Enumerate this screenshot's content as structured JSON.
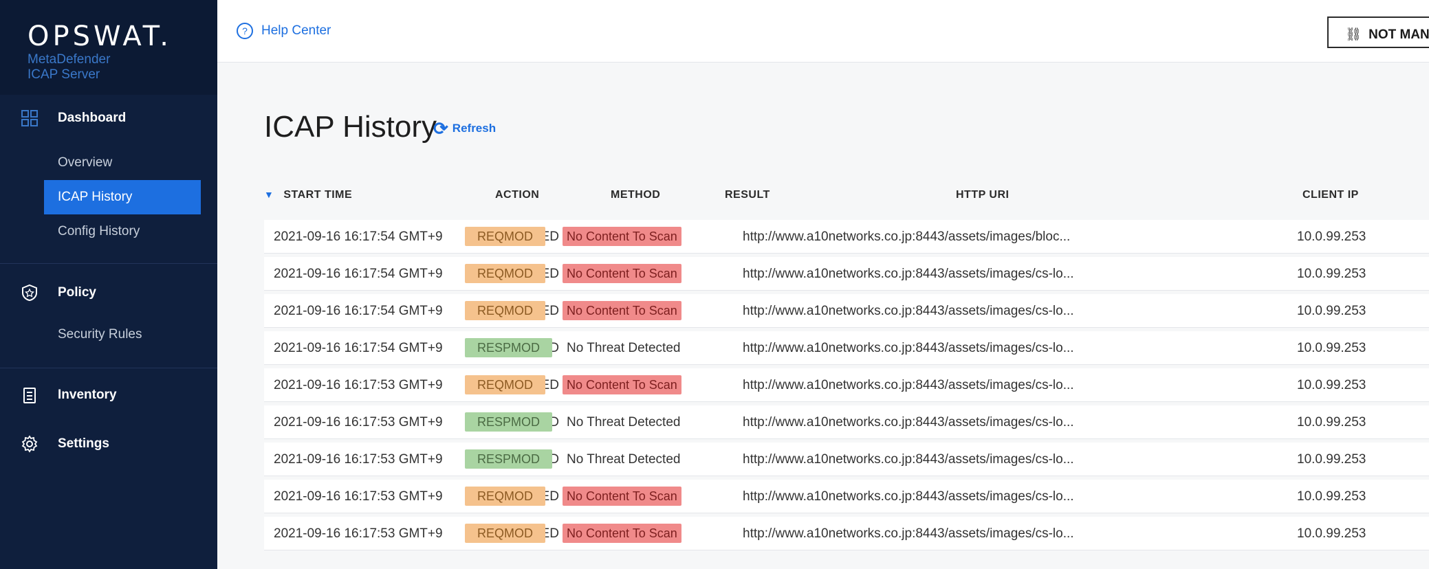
{
  "brand": {
    "logo": "OPSWAT.",
    "product_line1": "MetaDefender",
    "product_line2": "ICAP Server"
  },
  "sidebar": {
    "dashboard": {
      "label": "Dashboard",
      "icon": "grid-icon"
    },
    "overview": "Overview",
    "icap_history": "ICAP History",
    "config_history": "Config History",
    "policy": {
      "label": "Policy",
      "icon": "shield-icon"
    },
    "security_rules": "Security Rules",
    "inventory": {
      "label": "Inventory",
      "icon": "clipboard-icon"
    },
    "settings": {
      "label": "Settings",
      "icon": "gear-icon"
    }
  },
  "topbar": {
    "help_label": "Help Center",
    "help_icon": "question-icon",
    "status_label": "NOT MANA",
    "status_icon": "broken-link-icon"
  },
  "page": {
    "title": "ICAP History",
    "refresh_label": "Refresh",
    "refresh_icon": "refresh-icon"
  },
  "table": {
    "headers": {
      "start_time": "START TIME",
      "action": "ACTION",
      "method": "METHOD",
      "result": "RESULT",
      "http_uri": "HTTP URI",
      "client_ip": "CLIENT IP"
    },
    "rows": [
      {
        "start_time": "2021-09-16 16:17:54 GMT+9",
        "action": "ALLOWED",
        "method": "REQMOD",
        "result": "No Content To Scan",
        "uri": "http://www.a10networks.co.jp:8443/assets/images/bloc...",
        "ip": "10.0.99.253"
      },
      {
        "start_time": "2021-09-16 16:17:54 GMT+9",
        "action": "ALLOWED",
        "method": "REQMOD",
        "result": "No Content To Scan",
        "uri": "http://www.a10networks.co.jp:8443/assets/images/cs-lo...",
        "ip": "10.0.99.253"
      },
      {
        "start_time": "2021-09-16 16:17:54 GMT+9",
        "action": "ALLOWED",
        "method": "REQMOD",
        "result": "No Content To Scan",
        "uri": "http://www.a10networks.co.jp:8443/assets/images/cs-lo...",
        "ip": "10.0.99.253"
      },
      {
        "start_time": "2021-09-16 16:17:54 GMT+9",
        "action": "ALLOWED",
        "method": "RESPMOD",
        "result": "No Threat Detected",
        "uri": "http://www.a10networks.co.jp:8443/assets/images/cs-lo...",
        "ip": "10.0.99.253"
      },
      {
        "start_time": "2021-09-16 16:17:53 GMT+9",
        "action": "ALLOWED",
        "method": "REQMOD",
        "result": "No Content To Scan",
        "uri": "http://www.a10networks.co.jp:8443/assets/images/cs-lo...",
        "ip": "10.0.99.253"
      },
      {
        "start_time": "2021-09-16 16:17:53 GMT+9",
        "action": "ALLOWED",
        "method": "RESPMOD",
        "result": "No Threat Detected",
        "uri": "http://www.a10networks.co.jp:8443/assets/images/cs-lo...",
        "ip": "10.0.99.253"
      },
      {
        "start_time": "2021-09-16 16:17:53 GMT+9",
        "action": "ALLOWED",
        "method": "RESPMOD",
        "result": "No Threat Detected",
        "uri": "http://www.a10networks.co.jp:8443/assets/images/cs-lo...",
        "ip": "10.0.99.253"
      },
      {
        "start_time": "2021-09-16 16:17:53 GMT+9",
        "action": "ALLOWED",
        "method": "REQMOD",
        "result": "No Content To Scan",
        "uri": "http://www.a10networks.co.jp:8443/assets/images/cs-lo...",
        "ip": "10.0.99.253"
      },
      {
        "start_time": "2021-09-16 16:17:53 GMT+9",
        "action": "ALLOWED",
        "method": "REQMOD",
        "result": "No Content To Scan",
        "uri": "http://www.a10networks.co.jp:8443/assets/images/cs-lo...",
        "ip": "10.0.99.253"
      }
    ]
  },
  "colors": {
    "sidebar": "#0f1f3d",
    "accent": "#1d6fe0",
    "reqmod": "#f5c28d",
    "respmod": "#a9d4a2",
    "no_content": "#f08a8a"
  }
}
